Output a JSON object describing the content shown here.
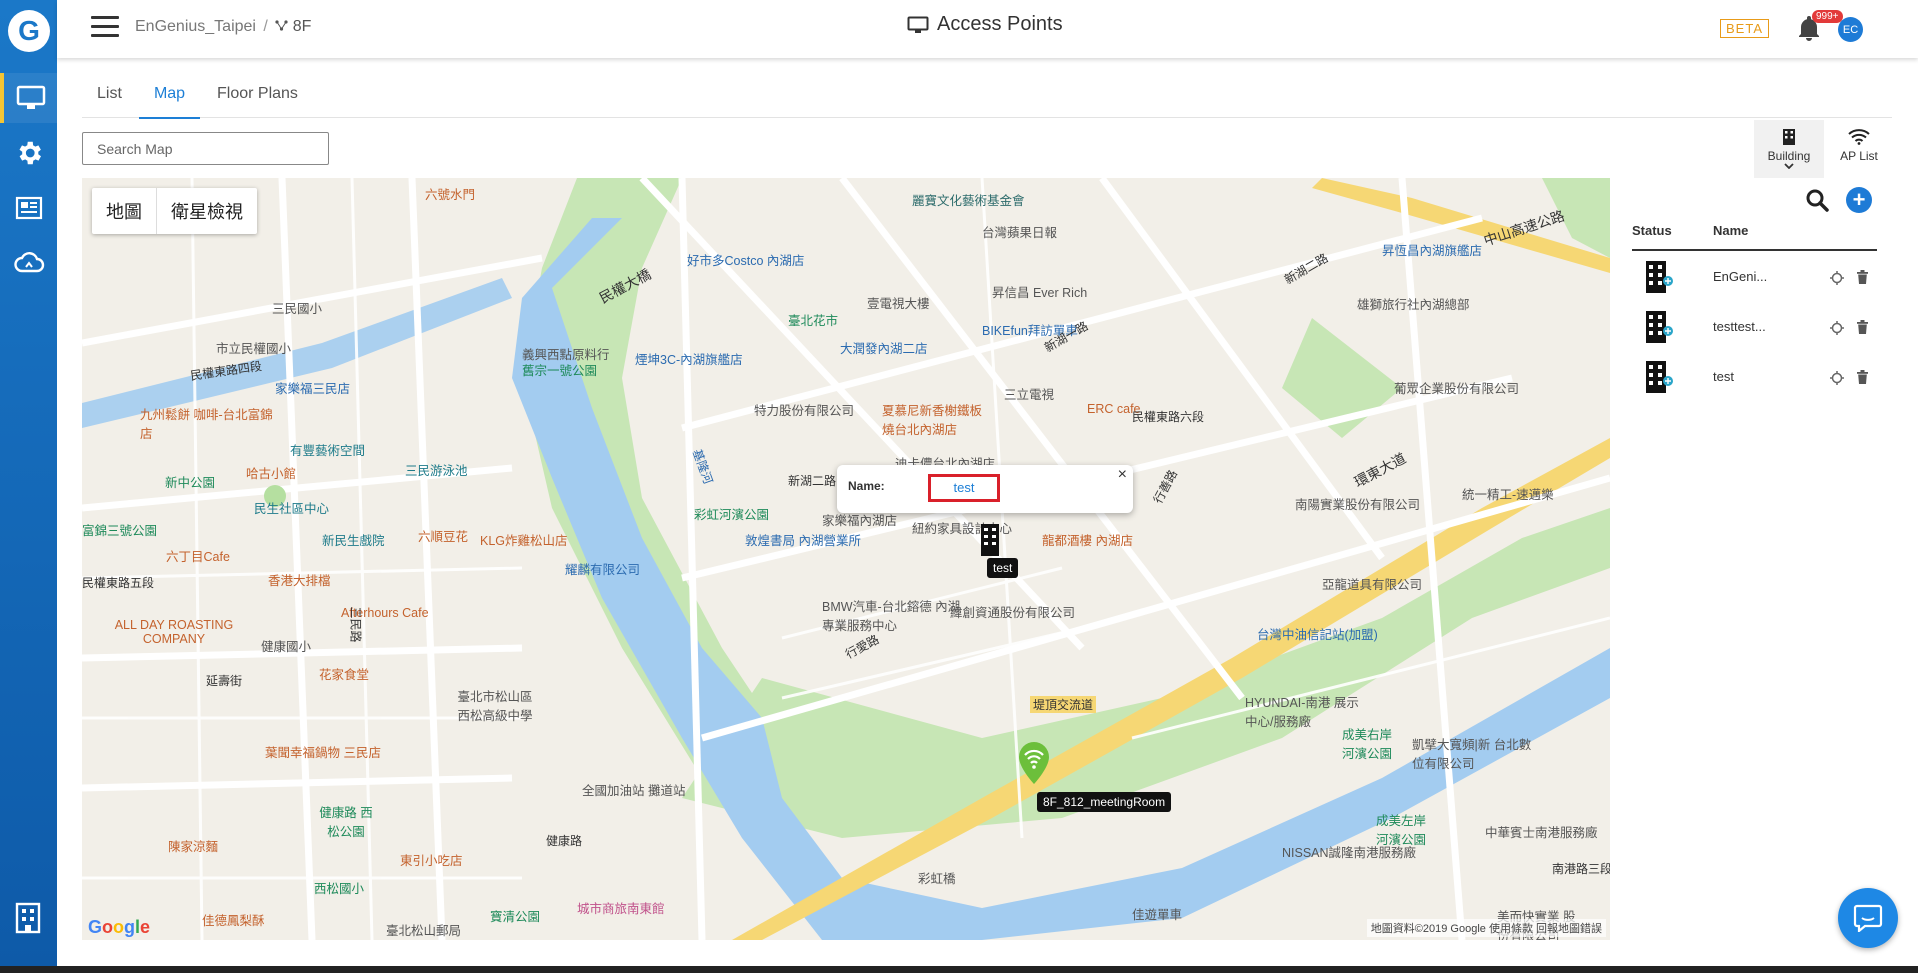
{
  "nav": {
    "items": [
      "dashboard",
      "settings",
      "reports",
      "cloud"
    ],
    "active": 0
  },
  "header": {
    "breadcrumb_org": "EnGenius_Taipei",
    "breadcrumb_sep": "/",
    "breadcrumb_floor": "8F",
    "title": "Access Points",
    "beta": "BETA",
    "notification_badge": "999+",
    "avatar": "EC"
  },
  "tabs": [
    {
      "label": "List",
      "active": false
    },
    {
      "label": "Map",
      "active": true
    },
    {
      "label": "Floor Plans",
      "active": false
    }
  ],
  "search": {
    "placeholder": "Search Map"
  },
  "tools": {
    "building_label": "Building",
    "ap_list_label": "AP List"
  },
  "map": {
    "type_map": "地圖",
    "type_satellite": "衛星檢視",
    "labels": [
      "六號水門",
      "麗寶文化藝術基金會",
      "好市多Costco 內湖店",
      "台灣蘋果日報",
      "昇恆昌內湖旗艦店",
      "壹電視大樓",
      "昇信昌 Ever Rich",
      "雄獅旅行社內湖總部",
      "三民國小",
      "臺北花市",
      "BIKEfun拜訪單車",
      "市立民權國小",
      "義興西點原料行",
      "煙坤3C-內湖旗艦店",
      "大潤發內湖二店",
      "家樂福三民店",
      "舊宗一號公園",
      "特力股份有限公司",
      "三立電視",
      "ERC cafe",
      "葡眾企業股份有限公司",
      "九州鬆餅 咖啡-台北富錦店",
      "夏慕尼新香榭鐵板燒台北內湖店",
      "有豐藝術空間",
      "哈古小館",
      "三民游泳池",
      "迪卡儂台北內湖店",
      "新中公園",
      "新湖二路",
      "民生社區中心",
      "彩虹河濱公園",
      "南陽實業股份有限公司",
      "統一精工-速邁樂",
      "家樂福內湖店",
      "紐約家具設計中心",
      "富錦三號公園",
      "新民生戲院",
      "六順豆花",
      "KLG炸雞松山店",
      "敦煌書局 內湖營業所",
      "龍都酒樓 內湖店",
      "六丁目Cafe",
      "香港大排檔",
      "耀麟有限公司",
      "亞龍道具有限公司",
      "BMW汽車-台北鎔德 內湖專業服務中心",
      "緯創資通股份有限公司",
      "Afterhours Cafe",
      "ALL DAY ROASTING COMPANY",
      "健康國小",
      "台灣中油信記站(加盟)",
      "花家食堂",
      "HYUNDAI-南港 展示中心/服務廠",
      "成美右岸 河濱公園",
      "凱擘大寬頻|新 台北數位有限公司",
      "臺北市松山區 西松高級中學",
      "堤頂交流道",
      "葉聞幸福鍋物 三民店",
      "全國加油站 攤道站",
      "健康路 西松公園",
      "成美左岸 河濱公園",
      "中華賓士南港服務廠",
      "陳家涼麵",
      "東引小吃店",
      "NISSAN誠隆南港服務廠",
      "西松國小",
      "彩虹橋",
      "佳德鳳梨酥",
      "城市商旅南東館",
      "寶清公園",
      "佳遊單車",
      "美而快實業 股份有限公司",
      "臺北松山郵局"
    ],
    "roads": [
      "民權大橋",
      "民權東路四段",
      "民權東路五段",
      "環東大道",
      "中山高速公路",
      "新湖二路",
      "新湖一路",
      "行善路",
      "基隆河",
      "南港路三段",
      "延壽街",
      "三民路",
      "健康路",
      "行愛路",
      "民權東路六段"
    ],
    "popup": {
      "name_label": "Name:",
      "name_value": "test",
      "close": "×"
    },
    "building_tag": "test",
    "ap_tag": "8F_812_meetingRoom",
    "copyright": "地圖資料©2019 Google   使用條款   回報地圖錯誤",
    "google": "Google"
  },
  "panel": {
    "col_status": "Status",
    "col_name": "Name",
    "rows": [
      {
        "name": "EnGeni..."
      },
      {
        "name": "testtest..."
      },
      {
        "name": "test"
      }
    ]
  },
  "colors": {
    "brand": "#1b78c8",
    "accent": "#1d7fd6",
    "highlight": "#d9202a",
    "beta": "#e89b19"
  }
}
